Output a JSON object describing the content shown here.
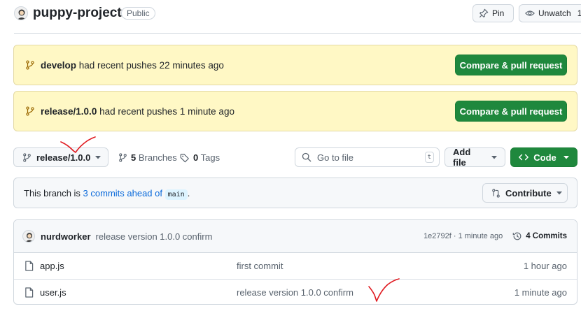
{
  "header": {
    "repo_name": "puppy-project",
    "visibility": "Public",
    "pin_label": "Pin",
    "watch_label": "Unwatch",
    "watch_count": "1"
  },
  "banners": [
    {
      "branch": "develop",
      "text": " had recent pushes 22 minutes ago",
      "button": "Compare & pull request"
    },
    {
      "branch": "release/1.0.0",
      "text": " had recent pushes 1 minute ago",
      "button": "Compare & pull request"
    }
  ],
  "toolbar": {
    "branch_selector": "release/1.0.0",
    "branches_count": "5",
    "branches_label": "Branches",
    "tags_count": "0",
    "tags_label": "Tags",
    "search_placeholder": "Go to file",
    "search_shortcut": "t",
    "add_file_label": "Add file",
    "code_label": "Code"
  },
  "ahead": {
    "prefix": "This branch is ",
    "link": "3 commits ahead of",
    "base_branch": "main",
    "suffix": ".",
    "contribute_label": "Contribute"
  },
  "latest_commit": {
    "author": "nurdworker",
    "message": "release version 1.0.0 confirm",
    "sha_time": "1e2792f · 1 minute ago",
    "commits_label": "4 Commits"
  },
  "files": [
    {
      "name": "app.js",
      "message": "first commit",
      "date": "1 hour ago"
    },
    {
      "name": "user.js",
      "message": "release version 1.0.0 confirm",
      "date": "1 minute ago"
    }
  ],
  "colors": {
    "green_button": "#1f883d",
    "banner_bg": "#fff8c5",
    "link_blue": "#0969da",
    "annotation_red": "#e0191f"
  },
  "icons": [
    "avatar-icon",
    "pin-icon",
    "eye-icon",
    "git-branch-icon",
    "tag-icon",
    "search-icon",
    "code-icon",
    "git-compare-icon",
    "history-icon",
    "file-icon",
    "triangle-down-icon"
  ]
}
